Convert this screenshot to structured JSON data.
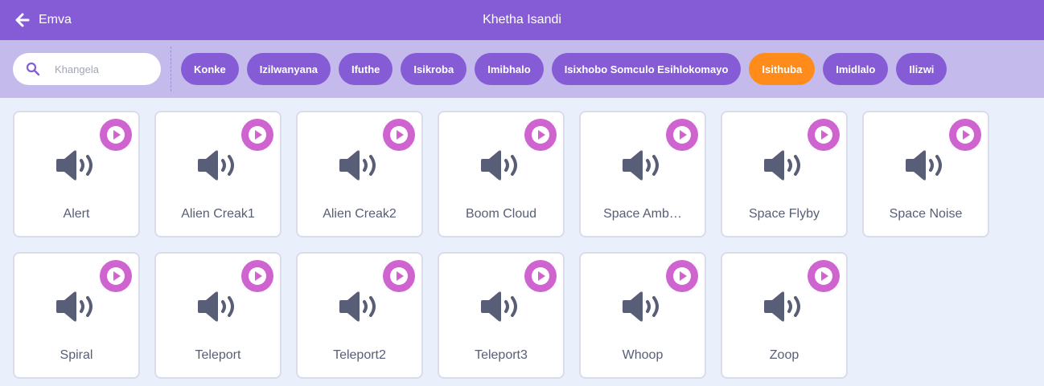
{
  "header": {
    "back_label": "Emva",
    "title": "Khetha Isandi"
  },
  "search": {
    "placeholder": "Khangela",
    "value": ""
  },
  "tags": [
    {
      "label": "Konke",
      "active": false
    },
    {
      "label": "Izilwanyana",
      "active": false
    },
    {
      "label": "Ifuthe",
      "active": false
    },
    {
      "label": "Isikroba",
      "active": false
    },
    {
      "label": "Imibhalo",
      "active": false
    },
    {
      "label": "Isixhobo Somculo Esihlokomayo",
      "active": false
    },
    {
      "label": "Isithuba",
      "active": true
    },
    {
      "label": "Imidlalo",
      "active": false
    },
    {
      "label": "Ilizwi",
      "active": false
    }
  ],
  "sounds": [
    {
      "name": "Alert"
    },
    {
      "name": "Alien Creak1"
    },
    {
      "name": "Alien Creak2"
    },
    {
      "name": "Boom Cloud"
    },
    {
      "name": "Space Amb…"
    },
    {
      "name": "Space Flyby"
    },
    {
      "name": "Space Noise"
    },
    {
      "name": "Spiral"
    },
    {
      "name": "Teleport"
    },
    {
      "name": "Teleport2"
    },
    {
      "name": "Teleport3"
    },
    {
      "name": "Whoop"
    },
    {
      "name": "Zoop"
    }
  ],
  "icons": {
    "back": "left-arrow-icon",
    "search": "search-icon",
    "play": "play-icon",
    "sound": "speaker-icon"
  },
  "colors": {
    "header_bg": "#855cd6",
    "filter_bg": "#c4bbec",
    "tag_bg": "#855cd6",
    "tag_active_bg": "#ff8c1a",
    "play_bg": "#cf63cf",
    "page_bg": "#e9f0fb",
    "icon_gray": "#575e75"
  }
}
